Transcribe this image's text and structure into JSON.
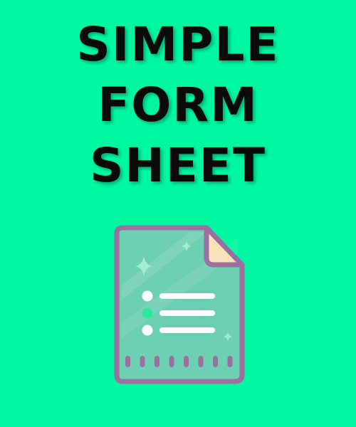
{
  "title": {
    "lines": [
      "SIMPLE",
      "FORM",
      "SHEET"
    ]
  },
  "icon": {
    "name": "form-document-icon",
    "bullet_rows": 3,
    "bottom_dashes": 8
  },
  "colors": {
    "background": "#00f7a1",
    "title_text": "#0b0b0b",
    "doc_fill": "#6ed0b2",
    "doc_border": "#9b6f9f",
    "corner_fold": "#f9e1b9",
    "bullet_white": "#ffffff",
    "bullet_highlight": "#2ce99a",
    "line_white": "#ffffff",
    "dash_purple": "#9b6f9f",
    "sparkle": "#a7ead3"
  }
}
